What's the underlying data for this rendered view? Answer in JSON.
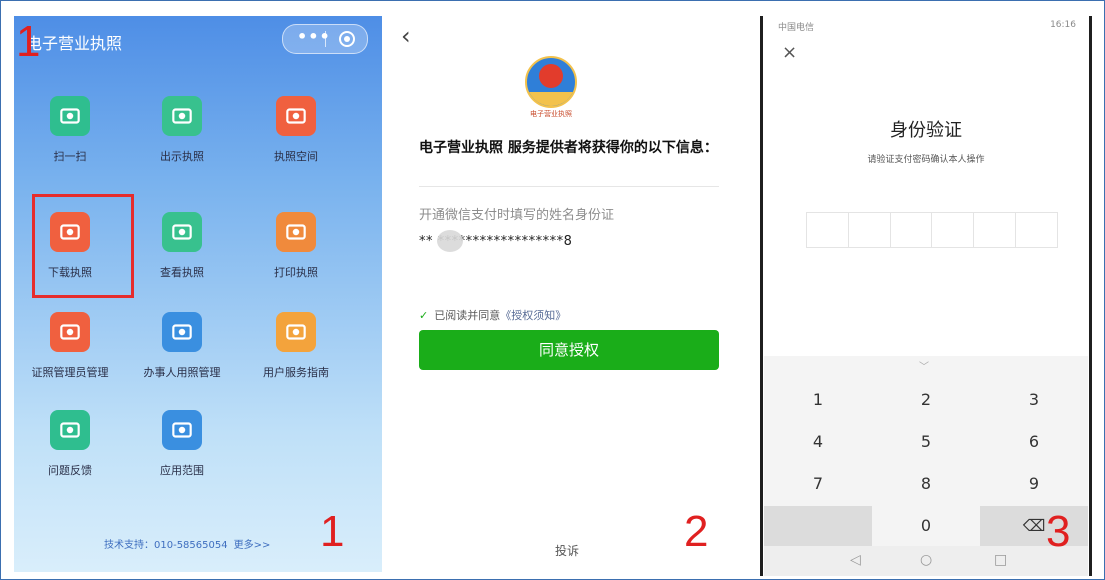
{
  "panel1": {
    "title": "电子营业执照",
    "step_marker_top": "1",
    "step_marker_bottom": "1",
    "menu_dots": "•••",
    "grid": [
      {
        "label": "扫一扫",
        "icon": "qr-scan-icon",
        "color": "#2fbe8f"
      },
      {
        "label": "出示执照",
        "icon": "license-card-icon",
        "color": "#38c18e"
      },
      {
        "label": "执照空间",
        "icon": "person-space-icon",
        "color": "#f0603f"
      },
      {
        "label": "下载执照",
        "icon": "download-license-icon",
        "color": "#f0603f"
      },
      {
        "label": "查看执照",
        "icon": "view-license-icon",
        "color": "#38c18e"
      },
      {
        "label": "打印执照",
        "icon": "print-license-icon",
        "color": "#f08a3c"
      },
      {
        "label": "证照管理员管理",
        "icon": "admin-manage-icon",
        "color": "#f0603f"
      },
      {
        "label": "办事人用照管理",
        "icon": "agent-manage-icon",
        "color": "#3a8fe0"
      },
      {
        "label": "用户服务指南",
        "icon": "guide-icon",
        "color": "#f3a33c"
      },
      {
        "label": "问题反馈",
        "icon": "feedback-icon",
        "color": "#2fbe8f"
      },
      {
        "label": "应用范围",
        "icon": "scope-icon",
        "color": "#3a8fe0"
      }
    ],
    "support_text": "技术支持：010-58565054",
    "support_more": "更多>>"
  },
  "panel2": {
    "back": "‹",
    "emblem_caption": "电子营业执照",
    "heading": "电子营业执照 服务提供者将获得你的以下信息：",
    "info_label": "开通微信支付时填写的姓名身份证",
    "info_value": "**                  ******************8",
    "agree_prefix": "已阅读并同意",
    "agree_link": "《授权须知》",
    "agree_button": "同意授权",
    "complain": "投诉",
    "step_marker": "2"
  },
  "panel3": {
    "status_left": "中国电信",
    "status_right": "16:16",
    "close": "×",
    "title": "身份验证",
    "subtitle": "请验证支付密码确认本人操作",
    "keys": [
      "1",
      "2",
      "3",
      "4",
      "5",
      "6",
      "7",
      "8",
      "9",
      "",
      "0",
      "⌫"
    ],
    "step_marker": "3",
    "nav": [
      "◁",
      "○",
      "□"
    ]
  }
}
